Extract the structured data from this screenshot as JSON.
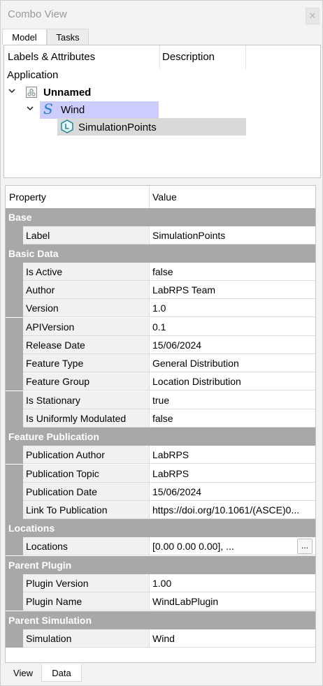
{
  "window": {
    "title": "Combo View",
    "close_glyph": "✕"
  },
  "top_tabs": [
    "Model",
    "Tasks"
  ],
  "tree": {
    "headers": [
      "Labels & Attributes",
      "Description"
    ],
    "root_label": "Application",
    "items": [
      {
        "label": "Unnamed",
        "icon": "document-icon"
      },
      {
        "label": "Wind",
        "icon": "simulation-s-icon"
      },
      {
        "label": "SimulationPoints",
        "icon": "location-feature-icon"
      }
    ]
  },
  "properties": {
    "headers": [
      "Property",
      "Value"
    ],
    "groups": [
      {
        "name": "Base",
        "rows": [
          {
            "name": "Label",
            "value": "SimulationPoints"
          }
        ]
      },
      {
        "name": "Basic Data",
        "rows": [
          {
            "name": "Is Active",
            "value": "false"
          },
          {
            "name": "Author",
            "value": "LabRPS Team"
          },
          {
            "name": "Version",
            "value": "1.0"
          },
          {
            "name": "APIVersion",
            "value": "0.1"
          },
          {
            "name": "Release Date",
            "value": "15/06/2024"
          },
          {
            "name": "Feature Type",
            "value": "General Distribution"
          },
          {
            "name": "Feature Group",
            "value": "Location Distribution"
          },
          {
            "name": "Is Stationary",
            "value": "true"
          },
          {
            "name": "Is Uniformly Modulated",
            "value": "false"
          }
        ]
      },
      {
        "name": "Feature Publication",
        "rows": [
          {
            "name": "Publication Author",
            "value": "LabRPS"
          },
          {
            "name": "Publication Topic",
            "value": "LabRPS"
          },
          {
            "name": "Publication Date",
            "value": "15/06/2024"
          },
          {
            "name": "Link To Publication",
            "value": "https://doi.org/10.1061/(ASCE)0..."
          }
        ]
      },
      {
        "name": "Locations",
        "rows": [
          {
            "name": "Locations",
            "value": "[0.00 0.00 0.00], ...",
            "button": "..."
          }
        ]
      },
      {
        "name": "Parent Plugin",
        "rows": [
          {
            "name": "Plugin Version",
            "value": "1.00"
          },
          {
            "name": "Plugin Name",
            "value": "WindLabPlugin"
          }
        ]
      },
      {
        "name": "Parent Simulation",
        "rows": [
          {
            "name": "Simulation",
            "value": "Wind"
          }
        ]
      }
    ]
  },
  "bottom_tabs": [
    "View",
    "Data"
  ]
}
